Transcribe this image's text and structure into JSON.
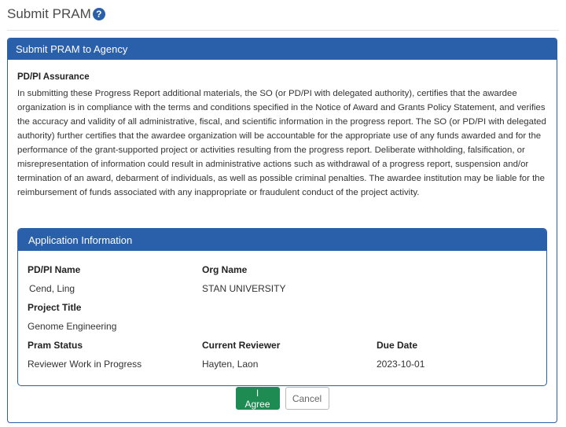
{
  "page": {
    "title": "Submit PRAM",
    "help_icon_glyph": "?"
  },
  "panel": {
    "title": "Submit PRAM to Agency",
    "assurance_heading": "PD/PI Assurance",
    "assurance_text": "In submitting these Progress Report additional materials, the SO (or PD/PI with delegated authority), certifies that the awardee organization is in compliance with the terms and conditions specified in the Notice of Award and Grants Policy Statement, and verifies the accuracy and validity of all administrative, fiscal, and scientific information in the progress report. The SO (or PD/PI with delegated authority) further certifies that the awardee organization will be accountable for the appropriate use of any funds awarded and for the performance of the grant-supported project or activities resulting from the progress report. Deliberate withholding, falsification, or misrepresentation of information could result in administrative actions such as withdrawal of a progress report, suspension and/or termination of an award, debarment of individuals, as well as possible criminal penalties. The awardee institution may be liable for the reimbursement of funds associated with any inappropriate or fraudulent conduct of the project activity."
  },
  "application_info": {
    "title": "Application Information",
    "pdpi_label": "PD/PI Name",
    "pdpi_value": "Cend, Ling",
    "org_label": "Org Name",
    "org_value": "STAN UNIVERSITY",
    "project_label": "Project Title",
    "project_value": "Genome Engineering",
    "status_label": "Pram Status",
    "status_value": "Reviewer Work in Progress",
    "reviewer_label": "Current Reviewer",
    "reviewer_value": "Hayten, Laon",
    "due_label": "Due Date",
    "due_value": "2023-10-01"
  },
  "actions": {
    "agree_label": "I Agree",
    "cancel_label": "Cancel"
  },
  "colors": {
    "header_blue": "#2a5fa9",
    "agree_green": "#1e8c52"
  },
  "icons": [
    "help-icon"
  ]
}
